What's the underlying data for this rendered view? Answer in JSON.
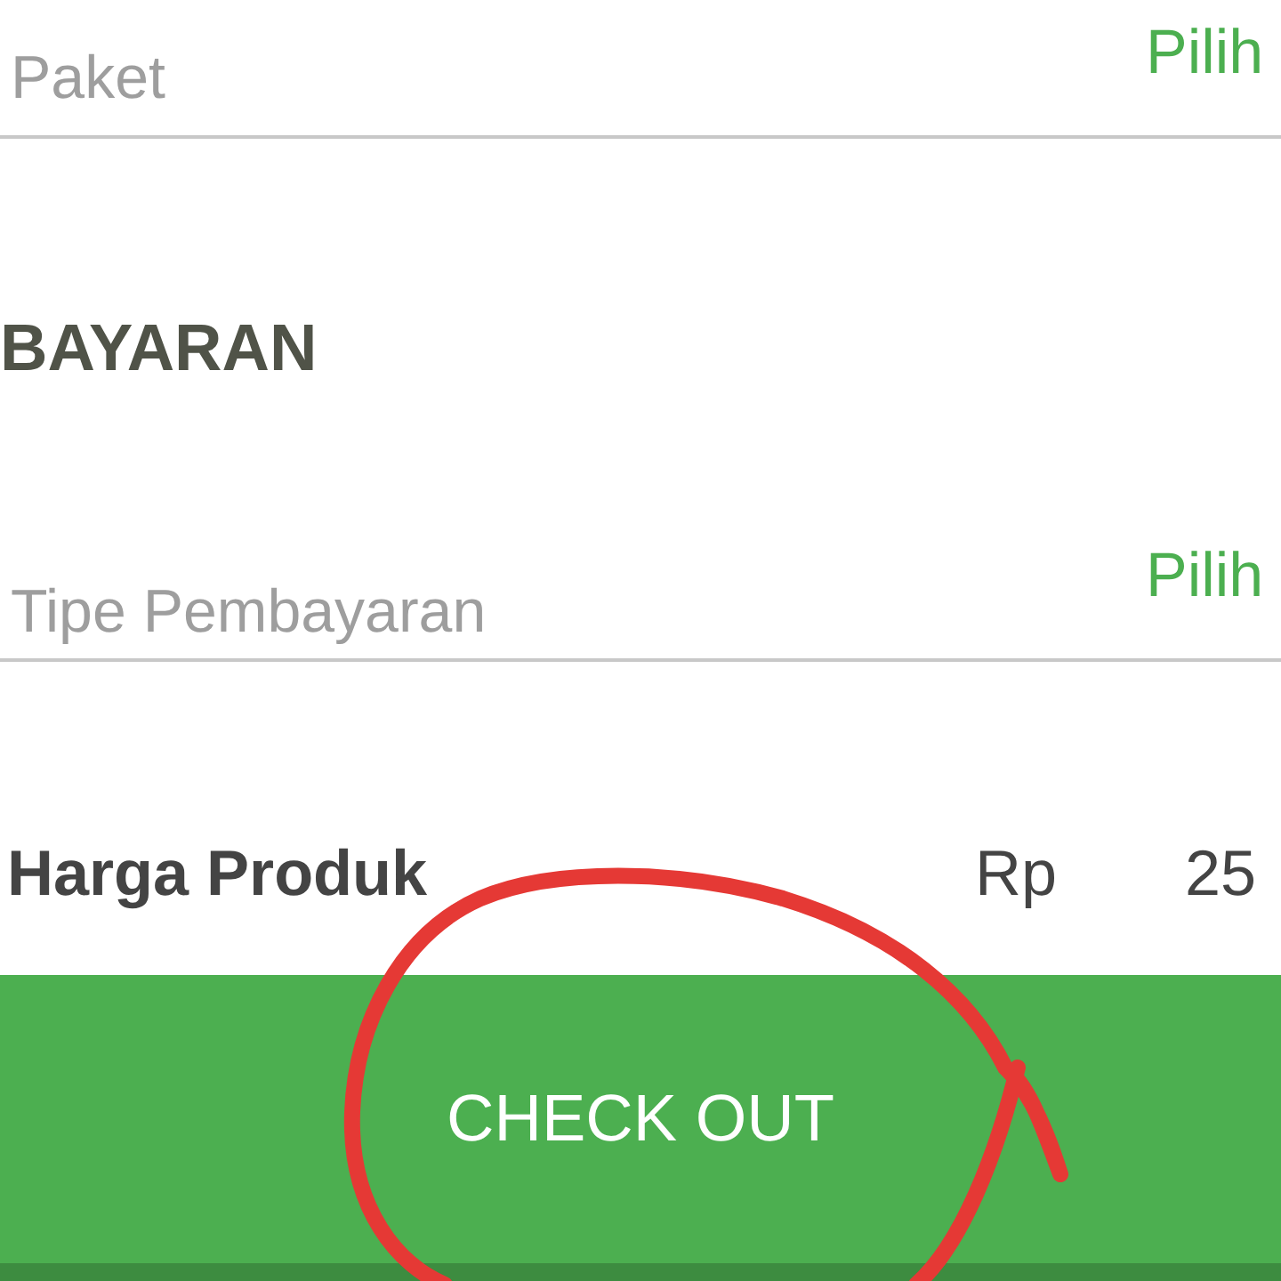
{
  "package_field": {
    "placeholder": "Paket",
    "action": "Pilih"
  },
  "payment_section": {
    "heading": "BAYARAN",
    "field": {
      "placeholder": "Tipe Pembayaran",
      "action": "Pilih"
    }
  },
  "price_row": {
    "label": "Harga Produk",
    "currency": "Rp",
    "amount": "25"
  },
  "checkout_button": {
    "label": "CHECK OUT"
  }
}
